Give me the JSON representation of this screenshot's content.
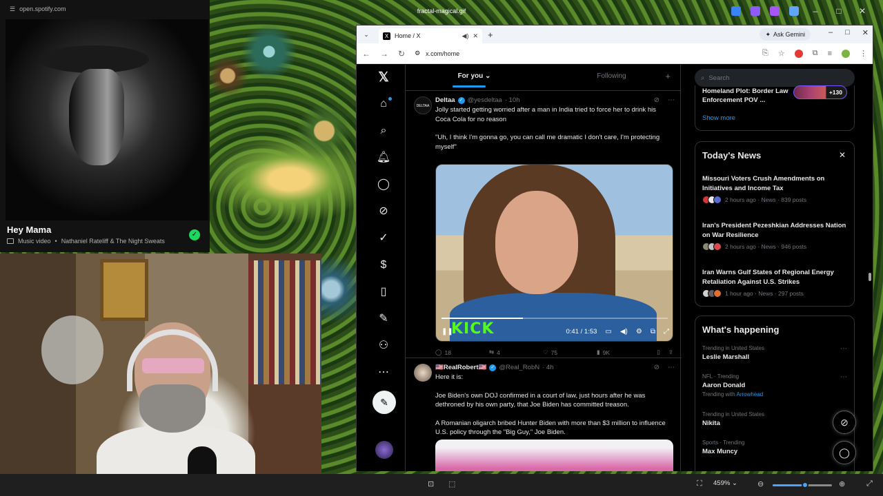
{
  "viewer": {
    "window_title": "fractal-magical.gif",
    "zoom_level": "459%",
    "zoom_slider_fraction": 0.55
  },
  "spotify": {
    "url": "open.spotify.com",
    "track_title": "Hey Mama",
    "type_label": "Music video",
    "separator": "•",
    "artist": "Nathaniel Rateliff & The Night Sweats"
  },
  "browser": {
    "tab_title": "Home / X",
    "url": "x.com/home",
    "gemini_label": "Ask Gemini"
  },
  "x": {
    "tabs": [
      {
        "label": "For you",
        "active": true
      },
      {
        "label": "Following",
        "active": false
      }
    ],
    "tweet1": {
      "name": "Deltaa",
      "handle": "@yesdeltaa",
      "time": "· 10h",
      "text1": "Jolly started getting worried after a man in India tried to force her to drink his Coca Cola for no reason",
      "text2": "\"Uh, I think I'm gonna go, you can call me dramatic I don't care, I'm protecting myself\"",
      "video_time": "0:41 / 1:53",
      "video_watermark": "KICK",
      "video_progress": 0.36,
      "replies": "18",
      "reposts": "4",
      "likes": "75",
      "views": "9K"
    },
    "tweet2": {
      "name": "🇺🇸RealRobert🇺🇸",
      "handle": "@Real_RobN",
      "time": "· 4h",
      "text1": "Here it is:",
      "text2": "Joe Biden's own DOJ confirmed in a court of law, just hours after he was dethroned by his own party, that Joe Biden has committed treason.",
      "text3": "A Romanian oligarch bribed Hunter Biden with more than $3 million to influence U.S. policy through the \"Big Guy,\" Joe Biden."
    },
    "search_placeholder": "Search",
    "top_card": {
      "title": "Homeland Plot: Border Law Enforcement POV ...",
      "count": "+130",
      "show_more": "Show more"
    },
    "todays_news": {
      "heading": "Today's News",
      "items": [
        {
          "title": "Missouri Voters Crush Amendments on Initiatives and Income Tax",
          "meta": "2 hours ago · News · 839 posts"
        },
        {
          "title": "Iran's President Pezeshkian Addresses Nation on War Resilience",
          "meta": "2 hours ago · News · 946 posts"
        },
        {
          "title": "Iran Warns Gulf States of Regional Energy Retaliation Against U.S. Strikes",
          "meta": "1 hour ago · News · 297 posts"
        }
      ]
    },
    "whats_happening": {
      "heading": "What's happening",
      "trends": [
        {
          "category": "Trending in United States",
          "name": "Leslie Marshall"
        },
        {
          "category": "NFL · Trending",
          "name": "Aaron Donald",
          "with_label": "Trending with",
          "with_value": "Arrowhead"
        },
        {
          "category": "Trending in United States",
          "name": "Nikita"
        },
        {
          "category": "Sports · Trending",
          "name": "Max Muncy"
        }
      ]
    }
  },
  "colors": {
    "accent": "#1d9bf0",
    "spotify_green": "#1ed760",
    "kick_green": "#53fc18"
  }
}
